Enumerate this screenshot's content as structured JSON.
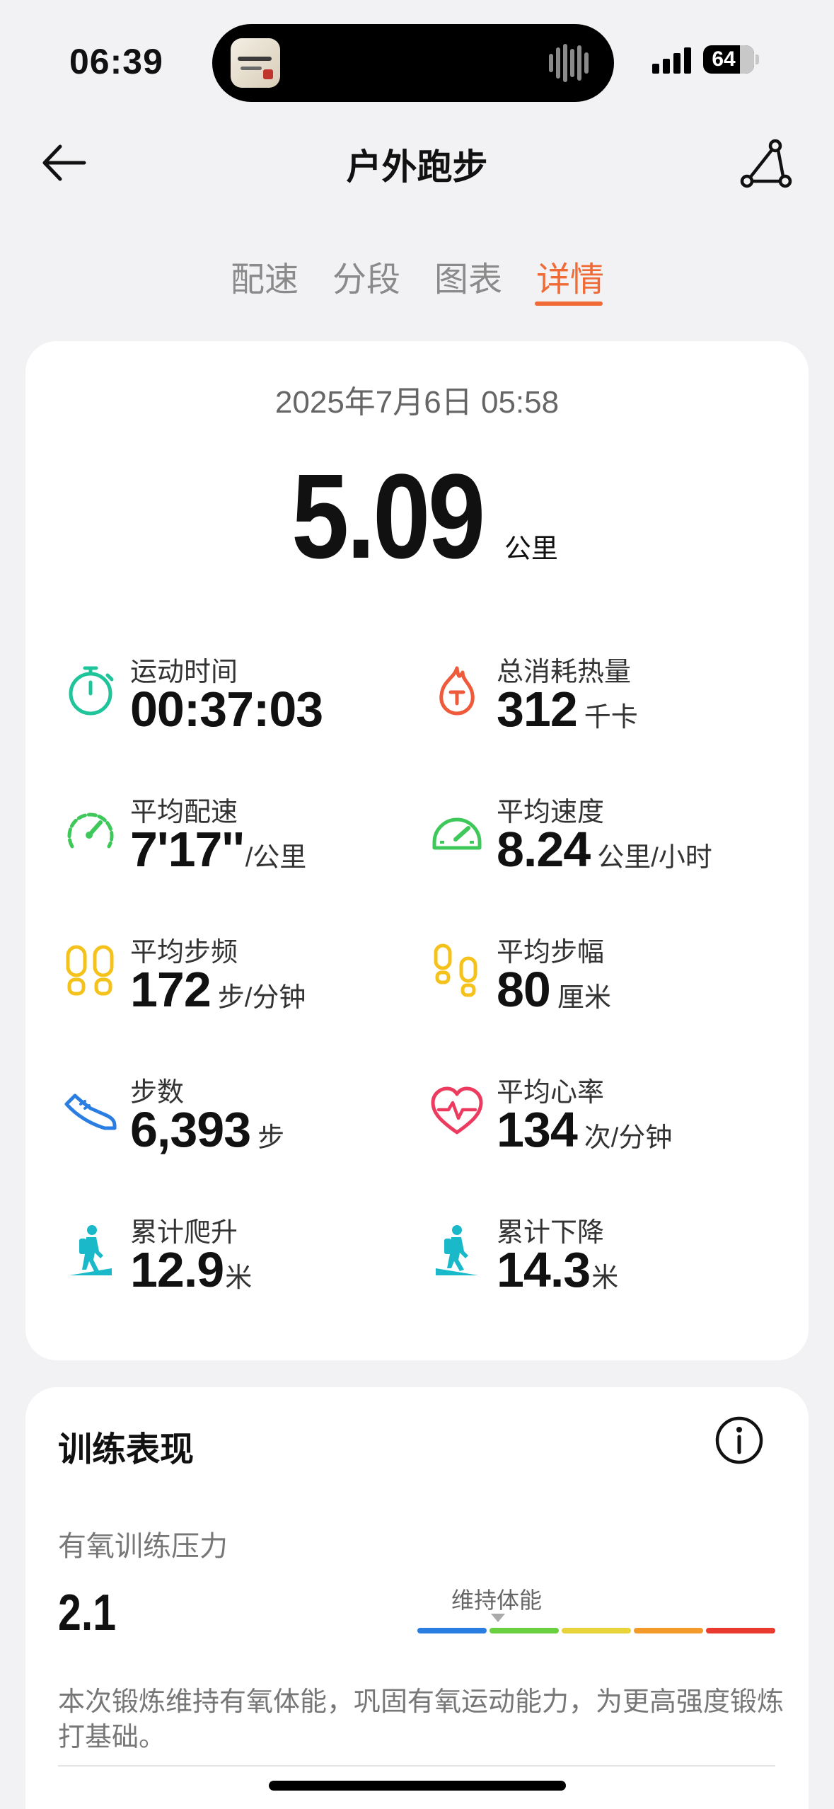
{
  "status_bar": {
    "time": "06:39",
    "battery": "64"
  },
  "header": {
    "title": "户外跑步"
  },
  "tabs": [
    {
      "label": "配速",
      "active": false
    },
    {
      "label": "分段",
      "active": false
    },
    {
      "label": "图表",
      "active": false
    },
    {
      "label": "详情",
      "active": true
    }
  ],
  "summary": {
    "date": "2025年7月6日 05:58",
    "distance": "5.09",
    "distance_unit": "公里"
  },
  "metrics": [
    {
      "label": "运动时间",
      "value": "00:37:03",
      "unit": "",
      "icon": "stopwatch-icon",
      "color": "#1fc49b"
    },
    {
      "label": "总消耗热量",
      "value": "312",
      "unit": "千卡",
      "icon": "calorie-flame-icon",
      "color": "#ee5a3a"
    },
    {
      "label": "平均配速",
      "value": "7'17''",
      "unit": "/公里",
      "icon": "pace-gauge-icon",
      "color": "#3fc85a"
    },
    {
      "label": "平均速度",
      "value": "8.24",
      "unit": "公里/小时",
      "icon": "speedometer-icon",
      "color": "#3fc85a"
    },
    {
      "label": "平均步频",
      "value": "172",
      "unit": "步/分钟",
      "icon": "footprints-icon",
      "color": "#f5c21b"
    },
    {
      "label": "平均步幅",
      "value": "80",
      "unit": "厘米",
      "icon": "stride-footprints-icon",
      "color": "#f5c21b"
    },
    {
      "label": "步数",
      "value": "6,393",
      "unit": "步",
      "icon": "running-shoe-icon",
      "color": "#2a7de1"
    },
    {
      "label": "平均心率",
      "value": "134",
      "unit": "次/分钟",
      "icon": "heart-rate-icon",
      "color": "#ec3b5e"
    },
    {
      "label": "累计爬升",
      "value": "12.9",
      "unit": "米",
      "icon": "hiker-uphill-icon",
      "color": "#19b9c9"
    },
    {
      "label": "累计下降",
      "value": "14.3",
      "unit": "米",
      "icon": "hiker-downhill-icon",
      "color": "#19b9c9"
    }
  ],
  "training": {
    "title": "训练表现",
    "aerobic_label": "有氧训练压力",
    "aerobic_value": "2.1",
    "aerobic_level": "维持体能",
    "scale_colors": [
      "#2a7de1",
      "#6bd03f",
      "#e8d43a",
      "#f39a2a",
      "#e83a2e"
    ],
    "description": "本次锻炼维持有氧体能，巩固有氧运动能力，为更高强度锻炼打基础。"
  },
  "colors": {
    "accent": "#f06a35",
    "background": "#f2f2f4"
  }
}
